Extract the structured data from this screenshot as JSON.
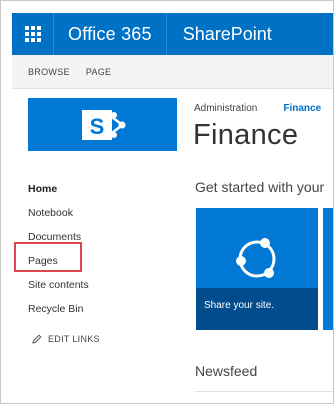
{
  "suitebar": {
    "brand": "Office 365",
    "app": "SharePoint",
    "color": "#0072c6"
  },
  "ribbon": {
    "tabs": [
      "BROWSE",
      "PAGE"
    ]
  },
  "leftnav": {
    "items": [
      {
        "label": "Home",
        "selected": true
      },
      {
        "label": "Notebook"
      },
      {
        "label": "Documents"
      },
      {
        "label": "Pages",
        "highlighted": true
      },
      {
        "label": "Site contents"
      },
      {
        "label": "Recycle Bin"
      }
    ],
    "edit_links": "EDIT LINKS",
    "highlight_color": "#e0474c"
  },
  "breadcrumb": {
    "parent": "Administration",
    "current": "Finance"
  },
  "page": {
    "title": "Finance",
    "get_started": "Get started with your",
    "tile_caption": "Share your site.",
    "newsfeed": "Newsfeed"
  },
  "icons": {
    "app_launcher": "waffle-icon",
    "site_logo": "sharepoint-logo-icon",
    "edit": "pencil-icon",
    "share": "share-icon"
  }
}
